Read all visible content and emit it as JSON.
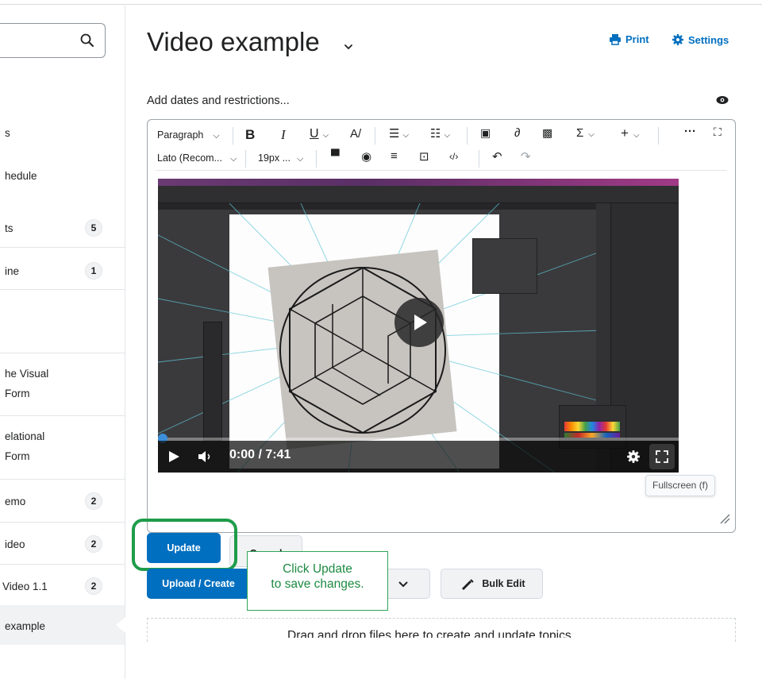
{
  "sidebar": {
    "items": [
      {
        "label": "s",
        "badge": ""
      },
      {
        "label": "hedule",
        "badge": ""
      },
      {
        "label": "ts",
        "badge": "5"
      },
      {
        "label": "ine",
        "badge": "1"
      },
      {
        "label": "he Visual",
        "label2": "Form",
        "badge": ""
      },
      {
        "label": "elational",
        "label2": "Form",
        "badge": ""
      },
      {
        "label": "emo",
        "badge": "2"
      },
      {
        "label": "ideo",
        "badge": "2"
      },
      {
        "label": "Video 1.1",
        "badge": "2"
      },
      {
        "label": "example",
        "badge": ""
      }
    ]
  },
  "header": {
    "title": "Video example",
    "print_label": "Print",
    "settings_label": "Settings"
  },
  "dates_link": "Add dates and restrictions...",
  "toolbar": {
    "paragraph": "Paragraph",
    "bold": "B",
    "italic": "I",
    "underline": "U",
    "sigma": "Σ",
    "plus": "+",
    "more": "···",
    "font": "Lato (Recom...",
    "size": "19px ..."
  },
  "video": {
    "time": "0:00 / 7:41",
    "progress": 0
  },
  "tooltip": "Fullscreen (f)",
  "buttons": {
    "update": "Update",
    "cancel": "Cancel",
    "upload_create": "Upload / Create",
    "bulk_edit": "Bulk Edit"
  },
  "callout": {
    "line1": "Click Update",
    "line2": "to save changes."
  },
  "dropzone": "Drag and drop files here to create and update topics",
  "colors": {
    "primary": "#006fbf",
    "highlight": "#1e9c4a"
  }
}
